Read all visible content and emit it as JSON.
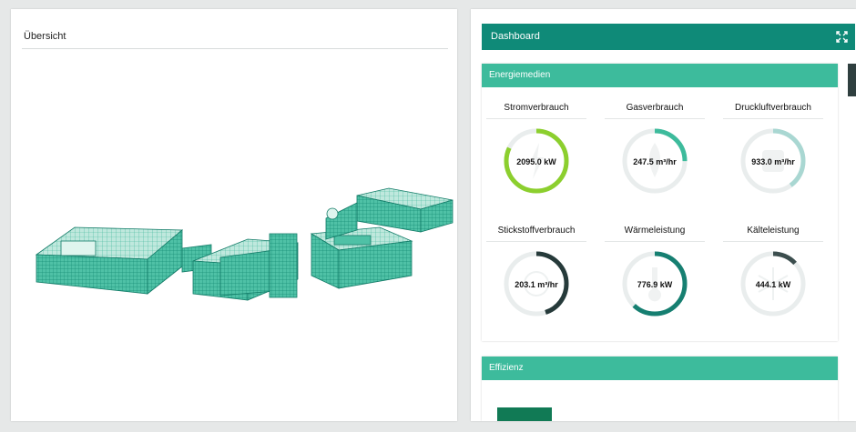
{
  "overview": {
    "title": "Übersicht"
  },
  "dashboard": {
    "title": "Dashboard"
  },
  "energy": {
    "title": "Energiemedien",
    "gauges": [
      {
        "label": "Stromverbrauch",
        "value": "2095.0 kW",
        "fraction": 0.82,
        "color": "#8ccf2e"
      },
      {
        "label": "Gasverbrauch",
        "value": "247.5 m³/hr",
        "fraction": 0.25,
        "color": "#3dbb9c"
      },
      {
        "label": "Druckluftverbrauch",
        "value": "933.0 m³/hr",
        "fraction": 0.4,
        "color": "#a9d7d2"
      },
      {
        "label": "Stickstoffverbrauch",
        "value": "203.1 m³/hr",
        "fraction": 0.45,
        "color": "#263a3a"
      },
      {
        "label": "Wärmeleistung",
        "value": "776.9 kW",
        "fraction": 0.62,
        "color": "#167f71"
      },
      {
        "label": "Kälteleistung",
        "value": "444.1 kW",
        "fraction": 0.13,
        "color": "#3c4e4e"
      }
    ]
  },
  "efficiency": {
    "title": "Effizienz"
  },
  "colors": {
    "header": "#0f8a78",
    "card_header": "#3dbb9c",
    "track": "#e9eded"
  },
  "icons": [
    "expand-icon",
    "lightning-icon",
    "flame-icon",
    "compressor-icon",
    "nitrogen-icon",
    "thermometer-icon",
    "snowflake-icon"
  ]
}
